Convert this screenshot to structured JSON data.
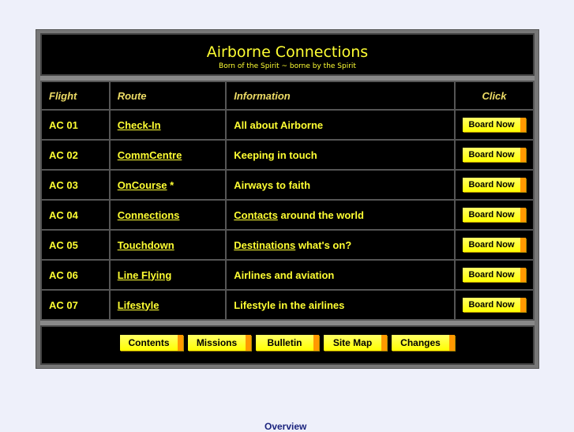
{
  "header": {
    "title": "Airborne Connections",
    "subtitle": "Born of the Spirit ~ borne by the Spirit"
  },
  "columns": [
    "Flight",
    "Route",
    "Information",
    "Click"
  ],
  "rows": [
    {
      "flight": "AC 01",
      "route": "Check-In",
      "route_suffix": "",
      "info_link": "",
      "info": "All about Airborne",
      "button": "Board Now"
    },
    {
      "flight": "AC 02",
      "route": "CommCentre",
      "route_suffix": "",
      "info_link": "",
      "info": "Keeping in touch",
      "button": "Board Now"
    },
    {
      "flight": "AC 03",
      "route": "OnCourse",
      "route_suffix": " *",
      "info_link": "",
      "info": "Airways to faith",
      "button": "Board Now"
    },
    {
      "flight": "AC 04",
      "route": "Connections",
      "route_suffix": "",
      "info_link": "Contacts",
      "info": " around the world",
      "button": "Board Now"
    },
    {
      "flight": "AC 05",
      "route": "Touchdown",
      "route_suffix": "",
      "info_link": "Destinations",
      "info": " what's on?",
      "button": "Board Now"
    },
    {
      "flight": "AC 06",
      "route": "Line Flying",
      "route_suffix": "",
      "info_link": "",
      "info": "Airlines and aviation",
      "button": "Board Now"
    },
    {
      "flight": "AC 07",
      "route": "Lifestyle",
      "route_suffix": "",
      "info_link": "",
      "info": "Lifestyle in the airlines",
      "button": "Board Now"
    }
  ],
  "footer": [
    "Contents",
    "Missions",
    "Bulletin",
    "Site Map",
    "Changes"
  ],
  "overview": "Overview",
  "colors": {
    "accent": "#ffff33",
    "button_edge": "#ff9900",
    "bg": "#000000"
  }
}
